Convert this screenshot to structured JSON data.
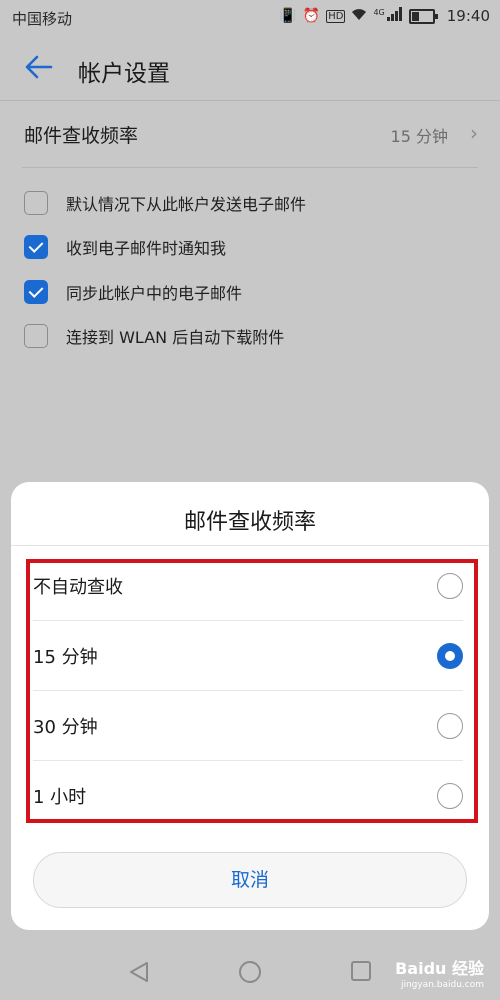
{
  "status": {
    "carrier": "中国移动",
    "time": "19:40",
    "icons": [
      "vibrate-icon",
      "alarm-icon",
      "hd-icon",
      "wifi-icon",
      "signal-icon",
      "battery-icon"
    ],
    "network": "4G"
  },
  "header": {
    "title": "帐户设置"
  },
  "settings": {
    "frequency_label": "邮件查收频率",
    "frequency_value": "15 分钟",
    "options": [
      {
        "label": "默认情况下从此帐户发送电子邮件",
        "checked": false
      },
      {
        "label": "收到电子邮件时通知我",
        "checked": true
      },
      {
        "label": "同步此帐户中的电子邮件",
        "checked": true
      },
      {
        "label": "连接到 WLAN 后自动下载附件",
        "checked": false
      }
    ]
  },
  "dialog": {
    "title": "邮件查收频率",
    "choices": [
      {
        "label": "不自动查收",
        "selected": false
      },
      {
        "label": "15 分钟",
        "selected": true
      },
      {
        "label": "30 分钟",
        "selected": false
      },
      {
        "label": "1 小时",
        "selected": false
      }
    ],
    "cancel": "取消"
  },
  "watermark": {
    "brand": "Baidu 经验",
    "site": "jingyan.baidu.com"
  },
  "colors": {
    "accent": "#1b6ad1",
    "highlight": "#d3131c"
  }
}
